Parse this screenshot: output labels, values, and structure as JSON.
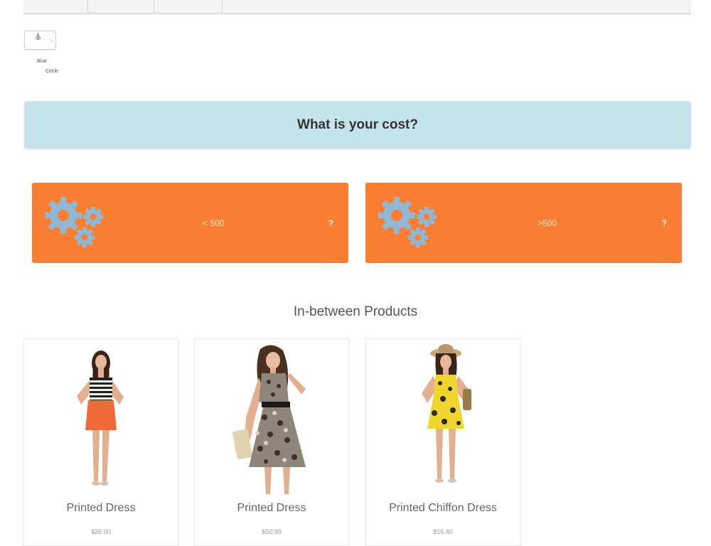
{
  "breadcrumb": {
    "home_icon": "home-icon",
    "items": [
      "Blue",
      "Circle"
    ]
  },
  "question": {
    "text": "What is your cost?"
  },
  "options": [
    {
      "label": "< 500",
      "help": "?",
      "icon": "gears-icon"
    },
    {
      "label": ">500",
      "help": "?",
      "icon": "gears-icon"
    }
  ],
  "section": {
    "title": "In-between Products"
  },
  "products": [
    {
      "name": "Printed Dress",
      "price": "$26.00"
    },
    {
      "name": "Printed Dress",
      "price": "$50.99"
    },
    {
      "name": "Printed Chiffon Dress",
      "price": "$16.40"
    }
  ],
  "colors": {
    "accent_orange": "#fb7f33",
    "banner_blue": "#c5e4ea",
    "gear_blue": "#8fb8d6"
  }
}
